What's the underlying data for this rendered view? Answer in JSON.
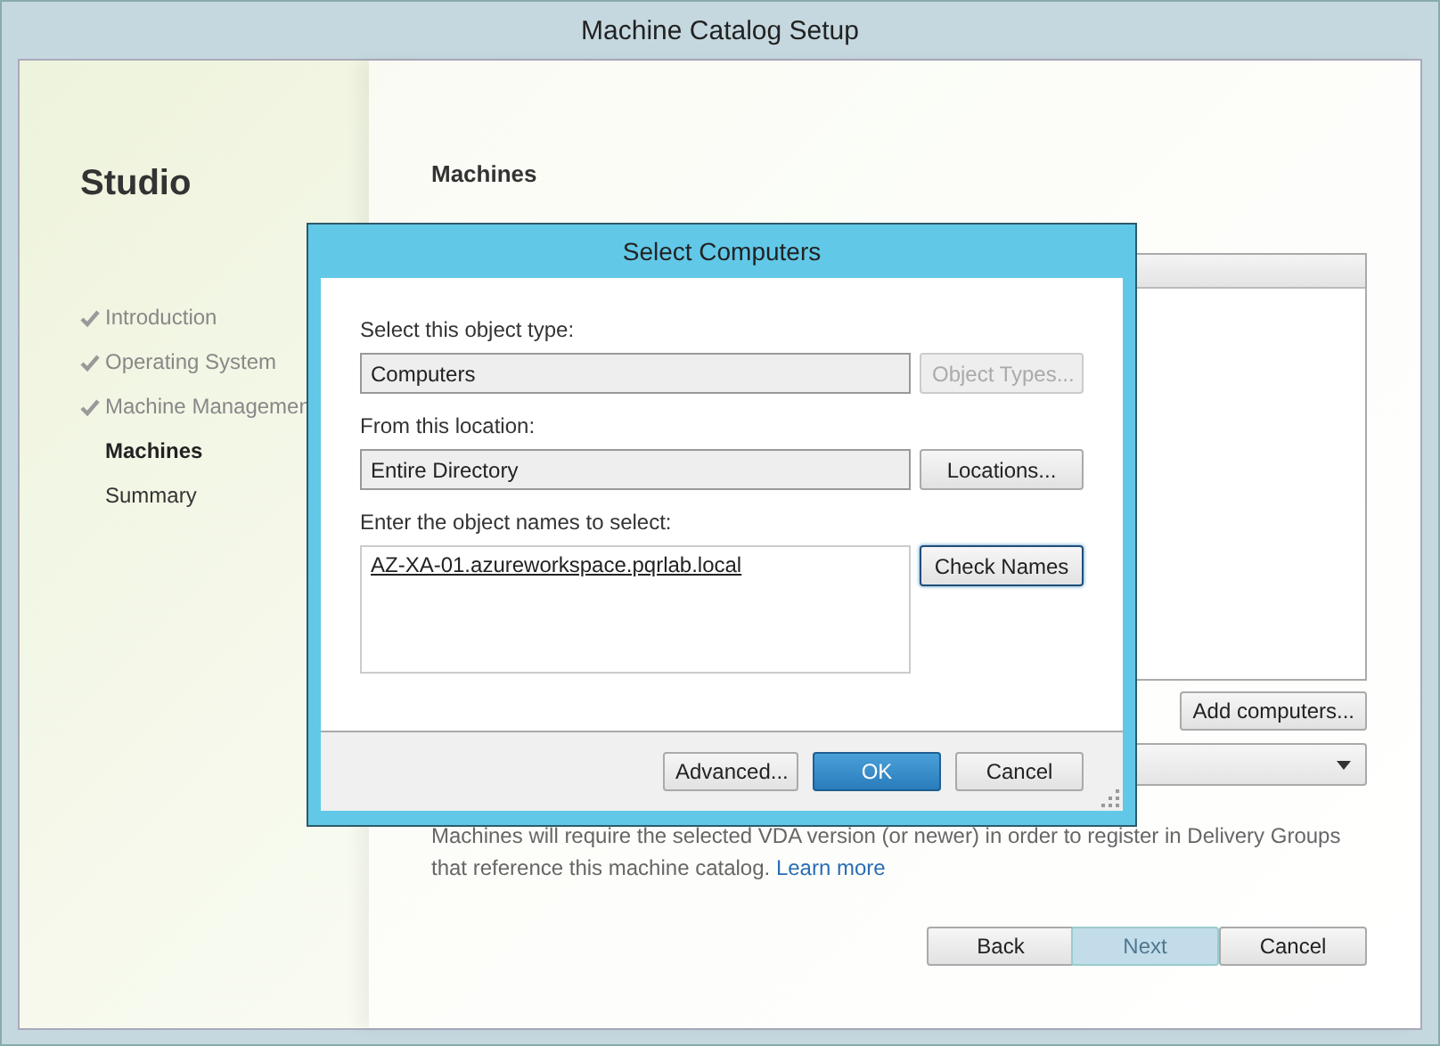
{
  "window": {
    "title": "Machine Catalog Setup"
  },
  "sidebar": {
    "title": "Studio",
    "steps": [
      {
        "label": "Introduction",
        "completed": true,
        "selected": false
      },
      {
        "label": "Operating System",
        "completed": true,
        "selected": false
      },
      {
        "label": "Machine Managemen",
        "completed": true,
        "selected": false
      },
      {
        "label": "Machines",
        "completed": false,
        "selected": true
      },
      {
        "label": "Summary",
        "completed": false,
        "selected": false
      }
    ]
  },
  "page": {
    "heading": "Machines",
    "add_button": "Add computers...",
    "note": "Machines will require the selected VDA version (or newer) in order to register in Delivery Groups that reference this machine catalog.",
    "note_link": "Learn more",
    "buttons": [
      {
        "label": "Back",
        "disabled": false
      },
      {
        "label": "Next",
        "disabled": true
      },
      {
        "label": "Cancel",
        "disabled": false
      }
    ]
  },
  "dialog": {
    "title": "Select Computers",
    "fields": [
      {
        "label": "Select this object type:",
        "value": "Computers",
        "button": "Object Types...",
        "button_disabled": true
      },
      {
        "label": "From this location:",
        "value": "Entire Directory",
        "button": "Locations...",
        "button_disabled": false
      }
    ],
    "names_label": "Enter the object names to select:",
    "names_value": "AZ-XA-01.azureworkspace.pqrlab.local",
    "check_button": "Check Names",
    "buttons": [
      {
        "label": "Advanced...",
        "default": false
      },
      {
        "label": "OK",
        "default": true
      },
      {
        "label": "Cancel",
        "default": false
      }
    ]
  }
}
